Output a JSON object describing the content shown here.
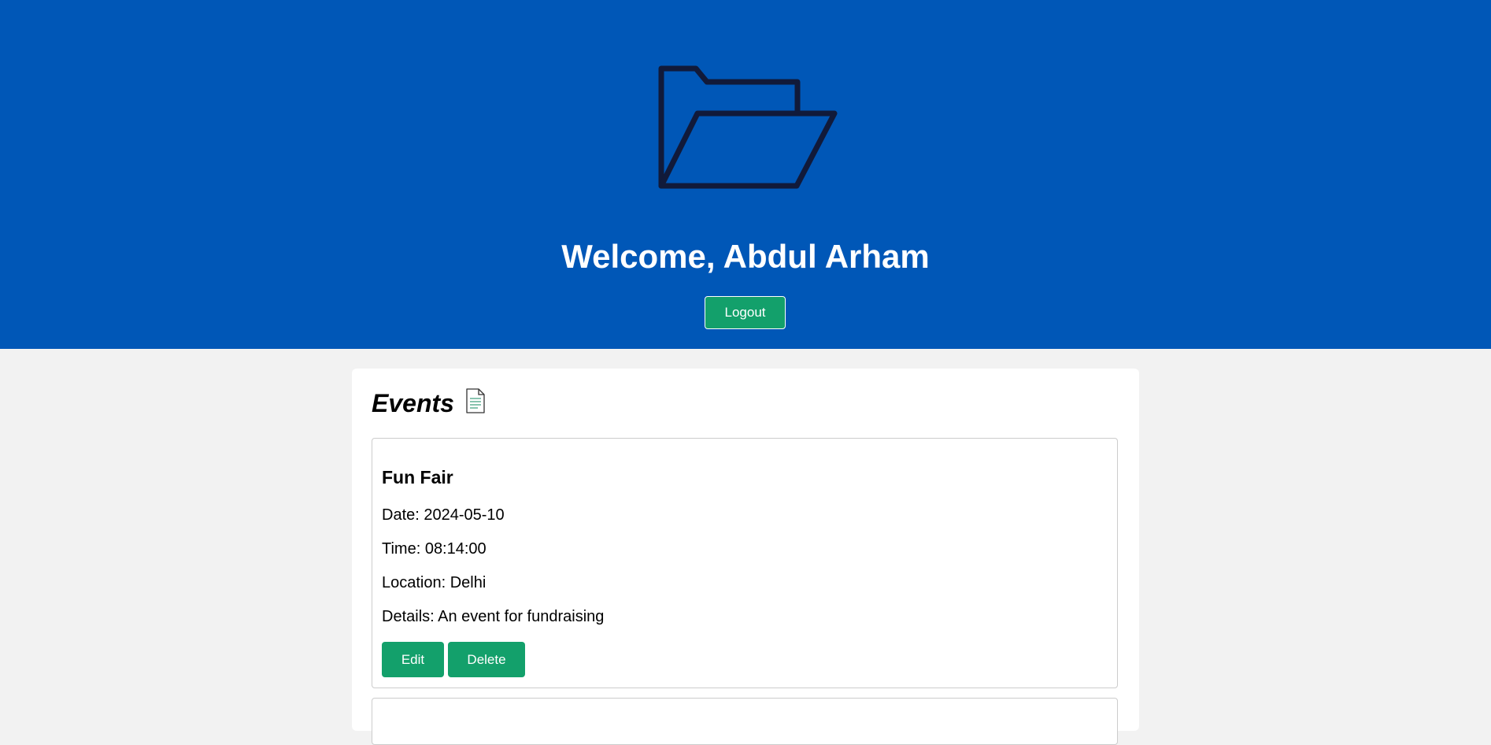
{
  "header": {
    "welcome_text": "Welcome, Abdul Arham",
    "logout_label": "Logout",
    "icon": "open-folder-icon",
    "background_color": "#0057b7"
  },
  "events_panel": {
    "title": "Events",
    "title_icon": "document-icon",
    "events": [
      {
        "name": "Fun Fair",
        "date": "Date: 2024-05-10",
        "time": "Time: 08:14:00",
        "location": "Location: Delhi",
        "details": "Details: An event for fundraising",
        "edit_label": "Edit",
        "delete_label": "Delete"
      }
    ]
  },
  "colors": {
    "accent_green": "#13a06b",
    "page_background": "#f2f2f2"
  }
}
